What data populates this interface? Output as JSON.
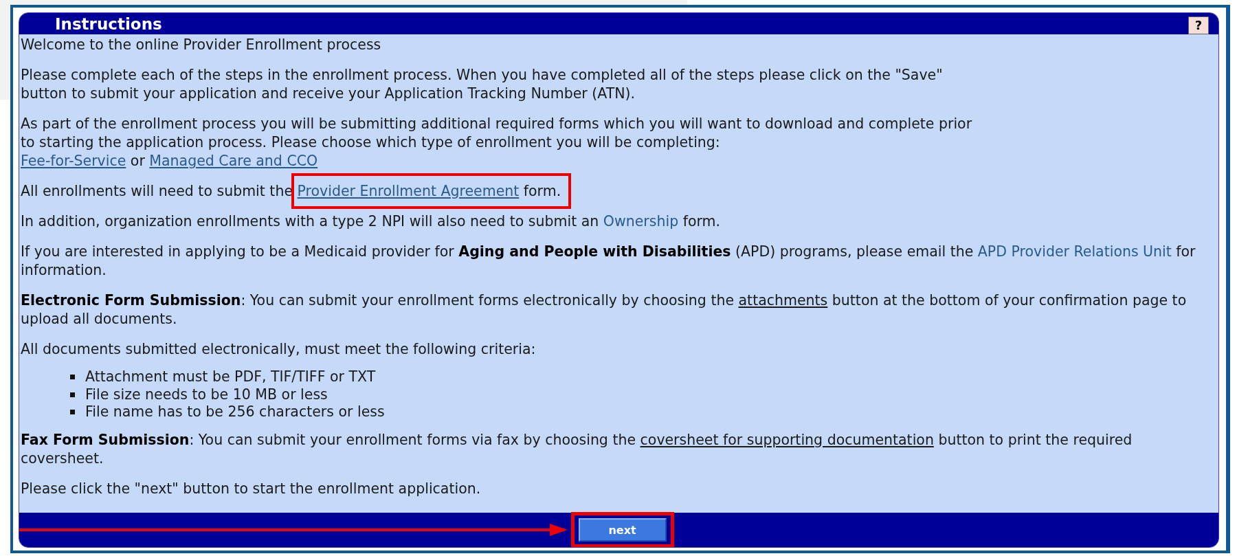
{
  "panel": {
    "title": "Instructions",
    "help_button": "?"
  },
  "content": [
    {
      "kind": "paragraph",
      "lines": [
        [
          {
            "kind": "text",
            "text": "Welcome to the online Provider Enrollment process"
          }
        ]
      ]
    },
    {
      "kind": "paragraph",
      "lines": [
        [
          {
            "kind": "text",
            "text": "Please complete each of the steps in the enrollment process. When you have completed all of the steps please click on the \"Save\""
          }
        ],
        [
          {
            "kind": "text",
            "text": "button to submit your application and receive your Application Tracking Number (ATN)."
          }
        ]
      ]
    },
    {
      "kind": "paragraph",
      "lines": [
        [
          {
            "kind": "text",
            "text": "As part of the enrollment process you will be submitting additional required forms which you will want to download and complete prior"
          }
        ],
        [
          {
            "kind": "text",
            "text": "to starting the application process. Please choose which type of enrollment you will be completing:"
          }
        ],
        [
          {
            "kind": "link",
            "text": "Fee-for-Service",
            "highlighted": false
          },
          {
            "kind": "text",
            "text": " or "
          },
          {
            "kind": "link",
            "text": "Managed Care and CCO",
            "highlighted": false
          }
        ]
      ]
    },
    {
      "kind": "paragraph",
      "lines": [
        [
          {
            "kind": "text",
            "text": "All enrollments will need to submit the "
          },
          {
            "kind": "link",
            "text": "Provider Enrollment Agreement",
            "highlighted": true
          },
          {
            "kind": "text",
            "text": " form."
          }
        ]
      ]
    },
    {
      "kind": "paragraph",
      "lines": [
        [
          {
            "kind": "text",
            "text": "In addition, organization enrollments with a type 2 NPI will also need to submit an "
          },
          {
            "kind": "plain_link",
            "text": "Ownership"
          },
          {
            "kind": "text",
            "text": " form."
          }
        ]
      ]
    },
    {
      "kind": "paragraph",
      "lines": [
        [
          {
            "kind": "text",
            "text": "If you are interested in applying to be a Medicaid provider for "
          },
          {
            "kind": "bold",
            "text": "Aging and People with Disabilities"
          },
          {
            "kind": "text",
            "text": " (APD) programs, please email the "
          },
          {
            "kind": "plain_link",
            "text": "APD Provider Relations Unit"
          },
          {
            "kind": "text",
            "text": " for information."
          }
        ]
      ]
    },
    {
      "kind": "paragraph",
      "lines": [
        [
          {
            "kind": "bold",
            "text": "Electronic Form Submission"
          },
          {
            "kind": "text",
            "text": ": You can submit your enrollment forms electronically by choosing the "
          },
          {
            "kind": "underline",
            "text": "attachments"
          },
          {
            "kind": "text",
            "text": " button at the bottom of your confirmation page to upload all documents."
          }
        ]
      ]
    },
    {
      "kind": "paragraph",
      "lines": [
        [
          {
            "kind": "text",
            "text": "All documents submitted electronically, must meet the following criteria:"
          }
        ]
      ]
    },
    {
      "kind": "bullets",
      "items": [
        "Attachment must be PDF, TIF/TIFF or TXT",
        "File size needs to be 10 MB or less",
        "File name has to be 256 characters or less"
      ]
    },
    {
      "kind": "paragraph",
      "lines": [
        [
          {
            "kind": "bold",
            "text": "Fax Form Submission"
          },
          {
            "kind": "text",
            "text": ": You can submit your enrollment forms via fax by choosing the "
          },
          {
            "kind": "underline",
            "text": "coversheet for supporting documentation"
          },
          {
            "kind": "text",
            "text": " button to print the required coversheet."
          }
        ]
      ]
    },
    {
      "kind": "paragraph",
      "lines": [
        [
          {
            "kind": "text",
            "text": "Please click the \"next\" button to start the enrollment application."
          }
        ]
      ]
    }
  ],
  "next_button": {
    "label": "next",
    "highlighted": true,
    "arrow": true
  }
}
